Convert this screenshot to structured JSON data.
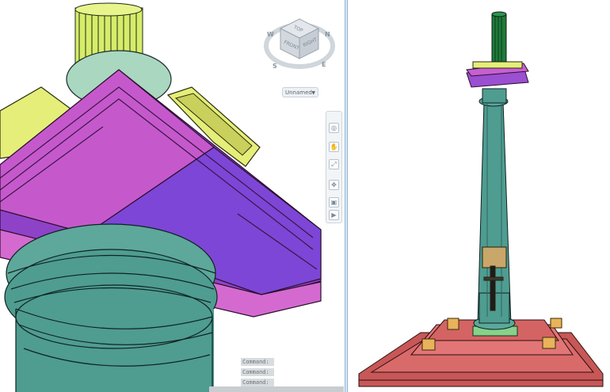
{
  "viewcube": {
    "top_label": "TOP",
    "front_label": "FRONT",
    "side_label": "RIGHT",
    "compass": {
      "n": "N",
      "e": "E",
      "s": "S",
      "w": "W"
    }
  },
  "viewport_menu": {
    "label": "Unnamed"
  },
  "navigation_bar": {
    "buttons": [
      {
        "icon": "steering-wheel-icon",
        "glyph": "◎"
      },
      {
        "icon": "pan-hand-icon",
        "glyph": "✋"
      },
      {
        "icon": "zoom-extents-icon",
        "glyph": "⤢"
      },
      {
        "icon": "orbit-icon",
        "glyph": "✥"
      },
      {
        "icon": "showmotion-icon",
        "glyph": "▣"
      },
      {
        "icon": "play-icon",
        "glyph": "▶"
      }
    ]
  },
  "command_history": [
    "Command:",
    "Command:",
    "Command:"
  ],
  "colors": {
    "column_teal": "#4f9c91",
    "capital_magenta": "#c457cf",
    "abacus_yellow": "#e7ef7c",
    "base_red": "#d26262",
    "divider_blue": "#8fb4d6"
  }
}
